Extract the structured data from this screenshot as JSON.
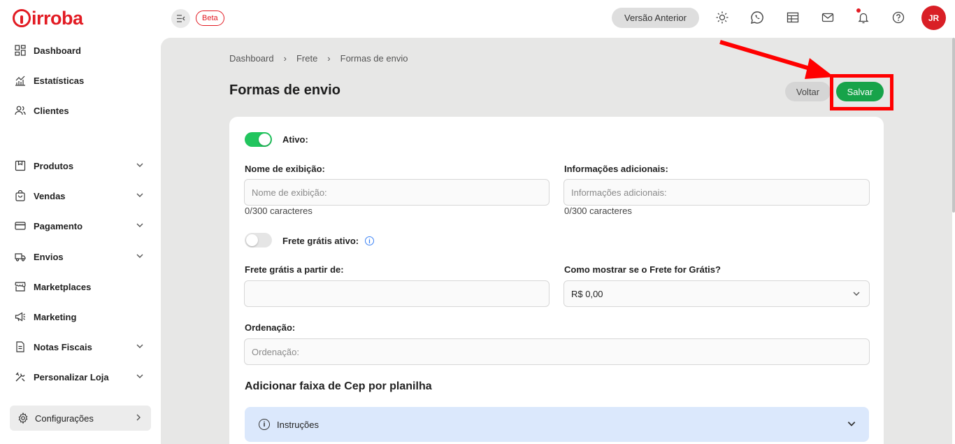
{
  "header": {
    "logo_text": "irroba",
    "beta_label": "Beta",
    "prev_version_label": "Versão Anterior",
    "avatar_initials": "JR",
    "icons": [
      "sun-icon",
      "whatsapp-icon",
      "calendar-icon",
      "mail-icon",
      "bell-icon",
      "help-icon"
    ]
  },
  "sidebar": {
    "items": [
      {
        "label": "Dashboard",
        "icon": "dashboard-icon"
      },
      {
        "label": "Estatísticas",
        "icon": "chart-icon"
      },
      {
        "label": "Clientes",
        "icon": "users-icon"
      },
      {
        "label": "Produtos",
        "icon": "box-icon"
      },
      {
        "label": "Vendas",
        "icon": "bag-icon"
      },
      {
        "label": "Pagamento",
        "icon": "card-icon"
      },
      {
        "label": "Envios",
        "icon": "truck-icon"
      },
      {
        "label": "Marketplaces",
        "icon": "store-icon"
      },
      {
        "label": "Marketing",
        "icon": "megaphone-icon"
      },
      {
        "label": "Notas Fiscais",
        "icon": "invoice-icon"
      },
      {
        "label": "Personalizar Loja",
        "icon": "tools-icon"
      }
    ],
    "config_label": "Configurações"
  },
  "breadcrumb": [
    "Dashboard",
    "Frete",
    "Formas de envio"
  ],
  "page": {
    "title": "Formas de envio",
    "back_label": "Voltar",
    "save_label": "Salvar"
  },
  "form": {
    "active_label": "Ativo:",
    "display_name_label": "Nome de exibição:",
    "display_name_placeholder": "Nome de exibição:",
    "display_name_counter": "0/300 caracteres",
    "additional_info_label": "Informações adicionais:",
    "additional_info_placeholder": "Informações adicionais:",
    "additional_info_counter": "0/300 caracteres",
    "free_shipping_label": "Frete grátis ativo:",
    "free_from_label": "Frete grátis a partir de:",
    "free_from_value": "",
    "how_show_label": "Como mostrar se o Frete for Grátis?",
    "how_show_value": "R$ 0,00",
    "order_label": "Ordenação:",
    "order_placeholder": "Ordenação:",
    "section_title": "Adicionar faixa de Cep por planilha",
    "instructions_label": "Instruções"
  },
  "colors": {
    "brand_red": "#e21b23",
    "save_green": "#17a34a",
    "toggle_green": "#22c55e",
    "annotation_red": "#ff0000"
  }
}
